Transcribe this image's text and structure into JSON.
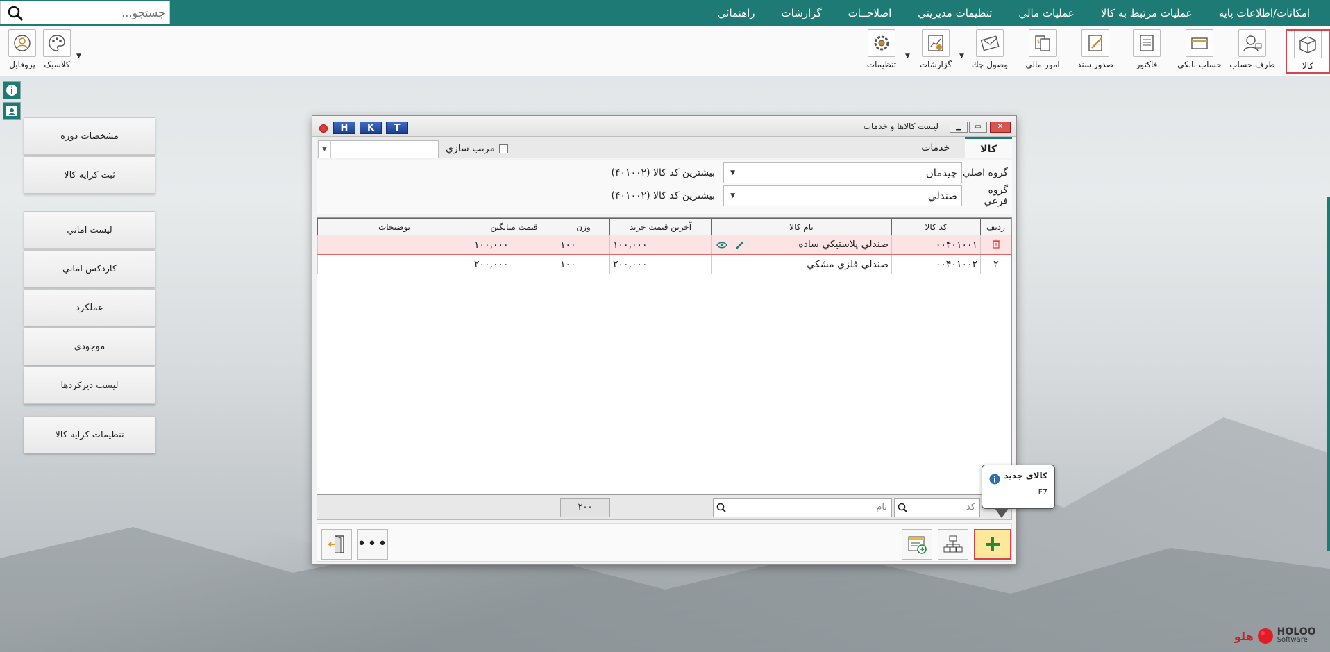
{
  "colors": {
    "accent": "#1e7a74",
    "highlight_red": "#d9434b",
    "new_yellow": "#fde89b"
  },
  "search": {
    "placeholder": "جستجو..."
  },
  "menu": [
    "امکانات/اطلاعات پايه",
    "عمليات مرتبط به کالا",
    "عمليات مالي",
    "تنظيمات مديريتي",
    "اصلاحــات",
    "گزارشات",
    "راهنمائي"
  ],
  "toolbar": {
    "items": [
      {
        "label": "کالا",
        "icon": "box-icon"
      },
      {
        "label": "طرف حساب",
        "icon": "person-icon"
      },
      {
        "label": "حساب بانکي",
        "icon": "bank-card-icon"
      },
      {
        "label": "فاکتور",
        "icon": "invoice-icon"
      },
      {
        "label": "صدور سند",
        "icon": "document-pen-icon"
      },
      {
        "label": "امور مالي",
        "icon": "finance-icon"
      },
      {
        "label": "وصول چك",
        "icon": "envelope-check-icon"
      },
      {
        "label": "گزارشات",
        "icon": "report-chart-icon"
      },
      {
        "label": "تنظيمات",
        "icon": "gear-icon"
      }
    ],
    "right": [
      {
        "label": "کلاسيک",
        "icon": "palette-icon"
      },
      {
        "label": "پروفايل",
        "icon": "profile-icon"
      }
    ]
  },
  "sidebar": [
    "مشخصات دوره",
    "ثبت کرايه کالا",
    "ليست اماني",
    "کاردکس اماني",
    "عملکرد",
    "موجودي",
    "ليست ديرکردها",
    "تنظيمات کرايه کالا"
  ],
  "window": {
    "title": "ليست کالاها و خدمات",
    "hkt": [
      "H",
      "K",
      "T"
    ],
    "tabs": [
      "کالا",
      "خدمات"
    ],
    "sort_label": "مرتب سازي",
    "filters": [
      {
        "label": "گروه اصلي",
        "value": "چيدمان",
        "note": "بيشترين کد کالا (۴۰۱۰۰۲)"
      },
      {
        "label": "گروه فرعي",
        "value": "صندلي",
        "note": "بيشترين کد کالا (۴۰۱۰۰۲)"
      }
    ],
    "columns": [
      "رديف",
      "کد کالا",
      "نام کالا",
      "آخرين قيمت خريد",
      "وزن",
      "قيمت ميانگين",
      "توضيحات"
    ],
    "rows": [
      {
        "index": "",
        "code": "۰۰۴۰۱۰۰۱",
        "name": "صندلي پلاستيکي ساده",
        "last_price": "۱۰۰,۰۰۰",
        "weight": "۱۰۰",
        "avg_price": "۱۰۰,۰۰۰",
        "desc": ""
      },
      {
        "index": "۲",
        "code": "۰۰۴۰۱۰۰۲",
        "name": "صندلي فلزي مشکي",
        "last_price": "۲۰۰,۰۰۰",
        "weight": "۱۰۰",
        "avg_price": "۲۰۰,۰۰۰",
        "desc": ""
      }
    ],
    "footer": {
      "code_placeholder": "کد",
      "name_placeholder": "نام",
      "weight_sum": "۲۰۰"
    }
  },
  "tooltip": {
    "title": "کالاي جديد",
    "shortcut": "F7"
  },
  "logo": {
    "name": "هلو",
    "brand": "HOLOO",
    "sub": "Software"
  }
}
